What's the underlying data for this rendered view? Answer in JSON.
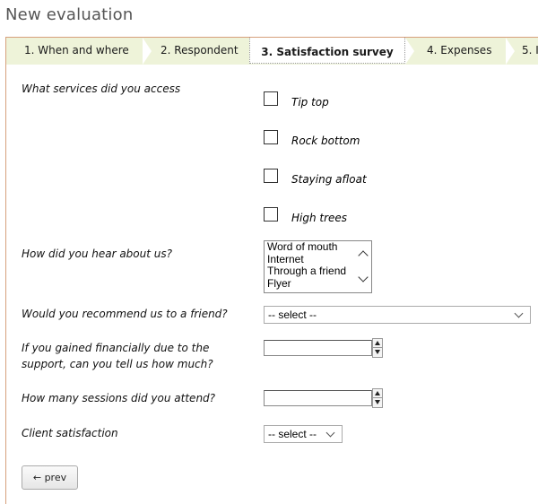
{
  "page": {
    "title": "New evaluation"
  },
  "tabs": [
    {
      "label": "1. When and where",
      "active": false
    },
    {
      "label": "2. Respondent",
      "active": false
    },
    {
      "label": "3. Satisfaction survey",
      "active": true
    },
    {
      "label": "4. Expenses",
      "active": false
    },
    {
      "label": "5. I",
      "active": false
    }
  ],
  "form": {
    "services": {
      "label": "What services did you access",
      "options": [
        {
          "label": "Tip top",
          "checked": false
        },
        {
          "label": "Rock bottom",
          "checked": false
        },
        {
          "label": "Staying afloat",
          "checked": false
        },
        {
          "label": "High trees",
          "checked": false
        }
      ]
    },
    "hear_about": {
      "label": "How did you hear about us?",
      "options": [
        "Word of mouth",
        "Internet",
        "Through a friend",
        "Flyer"
      ]
    },
    "recommend": {
      "label": "Would you recommend us to a friend?",
      "value": "-- select --"
    },
    "financial": {
      "label_line1": "If you gained financially due to the",
      "label_line2": "support, can you tell us how much?",
      "value": ""
    },
    "sessions": {
      "label": "How many sessions did you attend?",
      "value": ""
    },
    "satisfaction": {
      "label": "Client satisfaction",
      "value": "-- select --"
    }
  },
  "buttons": {
    "prev_label": "prev",
    "prev_icon": "arrow-left-icon"
  },
  "colors": {
    "tab_bg": "#eef3d9",
    "frame_border": "#d6a07c",
    "title": "#555555"
  }
}
